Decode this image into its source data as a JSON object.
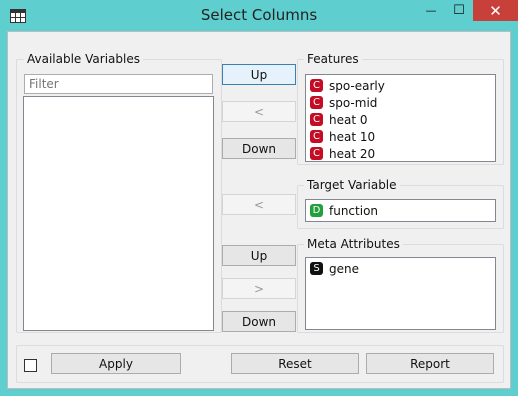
{
  "window": {
    "title": "Select Columns",
    "close_glyph": "✕",
    "minimize_glyph": "—",
    "maximize_glyph": "☐"
  },
  "available": {
    "title": "Available Variables",
    "filter_placeholder": "Filter"
  },
  "features": {
    "title": "Features",
    "items": [
      {
        "badge": "C",
        "label": "spo-early"
      },
      {
        "badge": "C",
        "label": "spo-mid"
      },
      {
        "badge": "C",
        "label": "heat 0"
      },
      {
        "badge": "C",
        "label": "heat 10"
      },
      {
        "badge": "C",
        "label": "heat 20"
      }
    ]
  },
  "target": {
    "title": "Target Variable",
    "items": [
      {
        "badge": "D",
        "label": "function"
      }
    ]
  },
  "meta": {
    "title": "Meta Attributes",
    "items": [
      {
        "badge": "S",
        "label": "gene"
      }
    ]
  },
  "buttons": {
    "features_up": "Up",
    "features_move": "<",
    "features_down": "Down",
    "target_move": "<",
    "meta_up": "Up",
    "meta_move": ">",
    "meta_down": "Down",
    "apply": "Apply",
    "reset": "Reset",
    "report": "Report"
  },
  "colors": {
    "titlebar": "#5ecfce",
    "close": "#c7403a",
    "continuous": "#c40d24",
    "discrete": "#23a03c",
    "string": "#111111"
  }
}
